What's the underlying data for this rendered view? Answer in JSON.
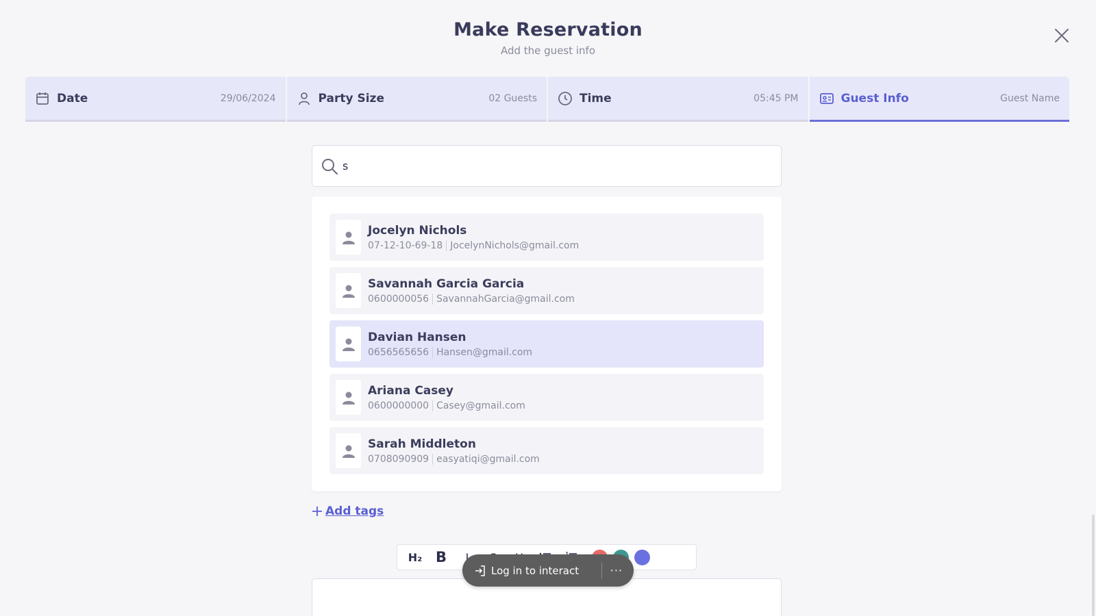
{
  "header": {
    "title": "Make Reservation",
    "subtitle": "Add the guest info"
  },
  "steps": [
    {
      "label": "Date",
      "value": "29/06/2024",
      "icon": "calendar-icon"
    },
    {
      "label": "Party Size",
      "value": "02 Guests",
      "icon": "person-icon"
    },
    {
      "label": "Time",
      "value": "05:45 PM",
      "icon": "clock-icon"
    },
    {
      "label": "Guest Info",
      "value": "Guest Name",
      "icon": "id-card-icon",
      "active": true
    }
  ],
  "search": {
    "value": "s"
  },
  "guests": [
    {
      "name": "Jocelyn Nichols",
      "phone": "07-12-10-69-18",
      "email": "JocelynNichols@gmail.com"
    },
    {
      "name": "Savannah Garcia Garcia",
      "phone": "0600000056",
      "email": "SavannahGarcia@gmail.com"
    },
    {
      "name": "Davian Hansen",
      "phone": "0656565656",
      "email": "Hansen@gmail.com",
      "selected": true
    },
    {
      "name": "Ariana Casey",
      "phone": "0600000000",
      "email": "Casey@gmail.com"
    },
    {
      "name": "Sarah Middleton",
      "phone": "0708090909",
      "email": "easyatiqi@gmail.com"
    }
  ],
  "add_tags": {
    "label": "Add tags"
  },
  "toolbar": {
    "h2": "H₂",
    "bold": "B",
    "italic": "I",
    "strike": "S",
    "underline": "U",
    "colors": [
      "#e86a6a",
      "#3d9a93",
      "#6b70e0"
    ]
  },
  "login_pill": {
    "label": "Log in to interact",
    "more": "···"
  },
  "colors": {
    "accent": "#5a5fd1",
    "step_bg": "#e7e7fa",
    "selected_row": "#e4e4fa",
    "page_bg": "#f6f6f8"
  }
}
